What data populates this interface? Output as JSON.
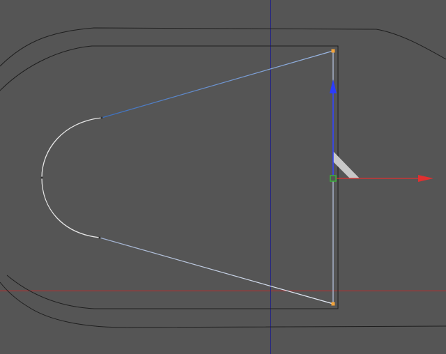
{
  "viewport": {
    "background": "#555555",
    "view": "top"
  },
  "colors": {
    "outline": "#222222",
    "spline_selected_start": "#3a6fbf",
    "spline_selected_end": "#dde6f5",
    "spline_arc": "#e6e6e6",
    "point": "#f2a33a",
    "origin_handle": "#39b339",
    "axis_x": "#e03030",
    "axis_y": "#2b3cff",
    "world_axis_x": "#c02a2a",
    "world_axis_y": "#1d1d8a",
    "plane_handle": "#c8c8c8"
  },
  "icons": {
    "axis_x_arrow": "arrow-right-icon",
    "axis_y_arrow": "arrow-up-icon",
    "origin_handle": "square-handle-icon",
    "point": "square-point-icon"
  }
}
